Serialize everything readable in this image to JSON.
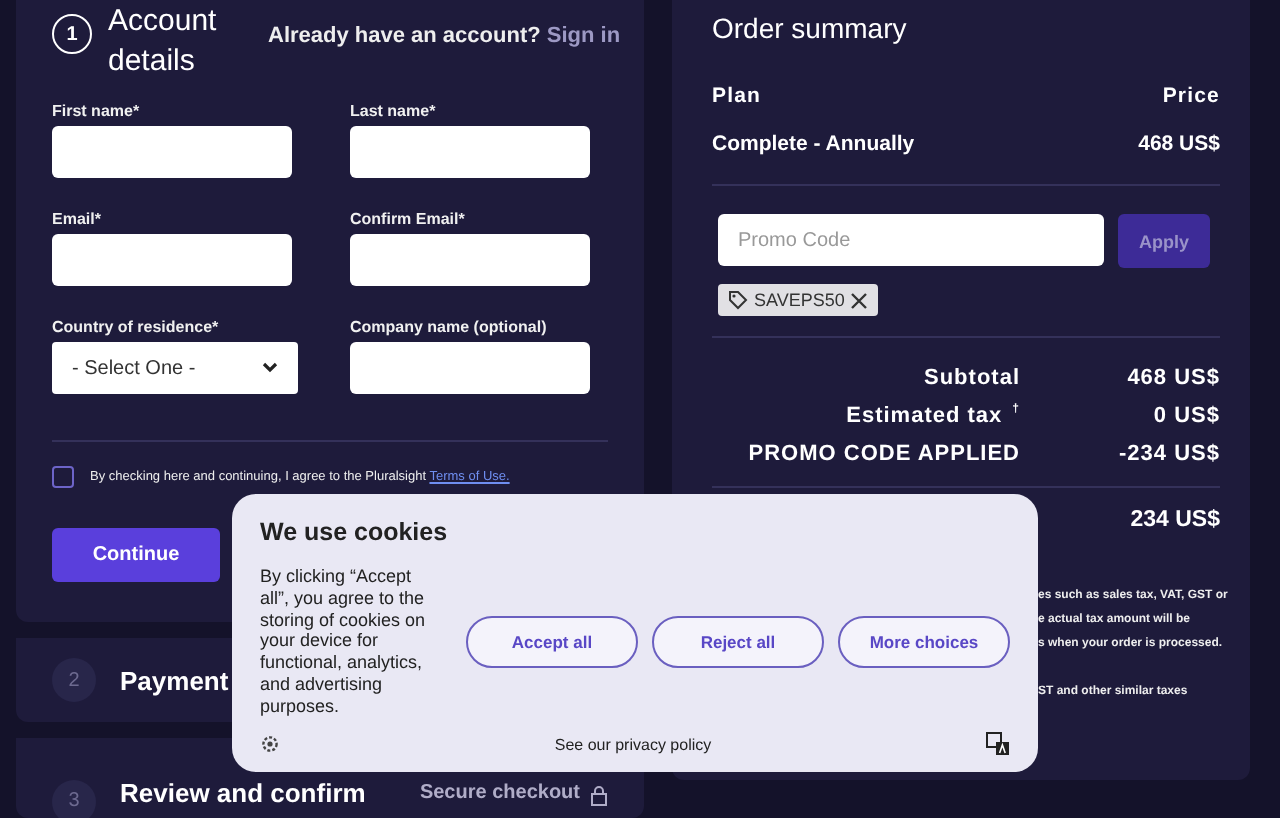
{
  "checkout": {
    "steps": [
      {
        "number": "1",
        "title": "Account details",
        "active": true
      },
      {
        "number": "2",
        "title": "Payment",
        "active": false
      },
      {
        "number": "3",
        "title": "Review and confirm",
        "active": false
      }
    ],
    "sign_in_prompt": "Already have an account?",
    "sign_in_link": "Sign in",
    "fields": [
      {
        "label": "First name*",
        "kind": "text"
      },
      {
        "label": "Last name*",
        "kind": "text"
      },
      {
        "label": "Email*",
        "kind": "text"
      },
      {
        "label": "Confirm Email*",
        "kind": "text"
      },
      {
        "label": "Country of residence*",
        "kind": "select",
        "value": "- Select One -"
      },
      {
        "label": "Company name (optional)",
        "kind": "text"
      }
    ],
    "terms": {
      "text": "By checking here and continuing, I agree to the Pluralsight",
      "link": "Terms of Use.",
      "checked": false
    },
    "continue_button": "Continue",
    "secure_checkout": "Secure checkout"
  },
  "order_summary": {
    "title": "Order summary",
    "columns": [
      "Plan",
      "Price"
    ],
    "plan": {
      "name": "Complete - Annually",
      "price": "468 US$"
    },
    "promo": {
      "placeholder": "Promo Code",
      "button": "Apply",
      "applied_code": "SAVEPS50"
    },
    "totals": [
      {
        "label": "Subtotal",
        "value": "468 US$"
      },
      {
        "label": "Estimated tax",
        "value": "0 US$",
        "note": "†"
      },
      {
        "label": "PROMO CODE APPLIED",
        "value": "-234 US$"
      }
    ],
    "total_value": "234 US$",
    "tax_note": [
      "es such as sales tax, VAT, GST or",
      "e actual tax amount will be",
      "s when your order is processed."
    ],
    "tax_note_2": "ST and other similar taxes"
  },
  "cookie_banner": {
    "title": "We use cookies",
    "text": "By clicking “Accept all”, you agree to the storing of cookies on your device for functional, analytics, and advertising purposes.",
    "buttons": [
      "Accept all",
      "Reject all",
      "More choices"
    ],
    "privacy_link": "See our privacy policy"
  }
}
